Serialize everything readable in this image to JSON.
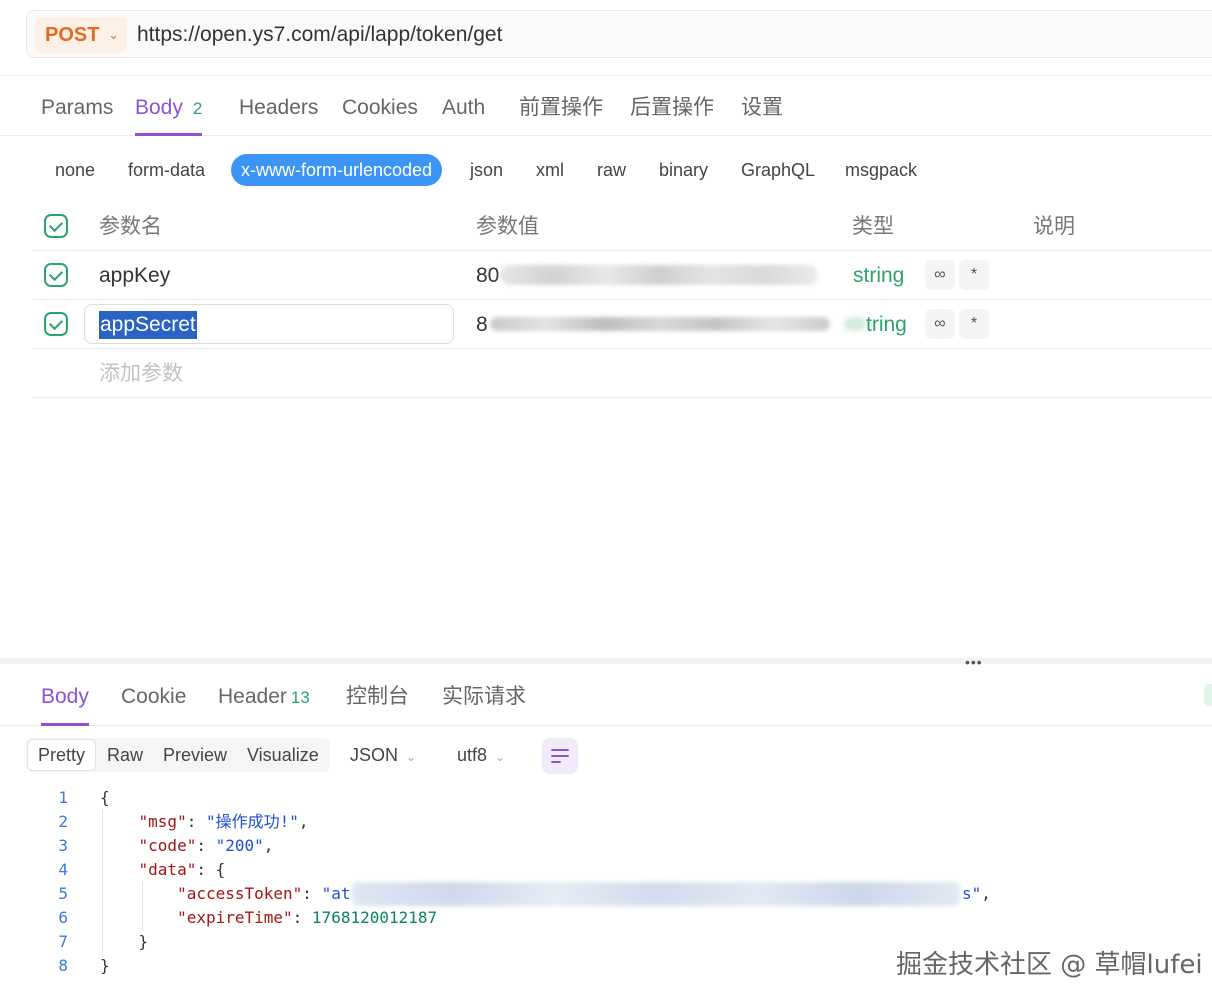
{
  "request": {
    "method": "POST",
    "url": "https://open.ys7.com/api/lapp/token/get"
  },
  "request_tabs": [
    {
      "label": "Params"
    },
    {
      "label": "Body",
      "count": "2"
    },
    {
      "label": "Headers"
    },
    {
      "label": "Cookies"
    },
    {
      "label": "Auth"
    },
    {
      "label": "前置操作"
    },
    {
      "label": "后置操作"
    },
    {
      "label": "设置"
    }
  ],
  "body_types": [
    "none",
    "form-data",
    "x-www-form-urlencoded",
    "json",
    "xml",
    "raw",
    "binary",
    "GraphQL",
    "msgpack"
  ],
  "params_table": {
    "headers": {
      "name": "参数名",
      "value": "参数值",
      "type": "类型",
      "description": "说明"
    },
    "rows": [
      {
        "name": "appKey",
        "value_visible": "80",
        "type": "string",
        "enabled": true
      },
      {
        "name": "appSecret",
        "value_visible": "8",
        "type": "tring",
        "enabled": true
      }
    ],
    "add_placeholder": "添加参数"
  },
  "icons": {
    "dropdown": "chevron-down-icon",
    "link": "link-icon",
    "required": "asterisk-icon",
    "wrap": "wrap-lines-icon",
    "check": "check-icon"
  },
  "colors": {
    "accent": "#8c52d6",
    "method": "#e56a1e",
    "success": "#2aa56a",
    "selected_chip": "#3c95f4"
  },
  "response_tabs": [
    {
      "label": "Body"
    },
    {
      "label": "Cookie"
    },
    {
      "label": "Header",
      "count": "13"
    },
    {
      "label": "控制台"
    },
    {
      "label": "实际请求"
    }
  ],
  "response_view": {
    "modes": [
      "Pretty",
      "Raw",
      "Preview",
      "Visualize"
    ],
    "format": "JSON",
    "encoding": "utf8"
  },
  "response_code": {
    "line_numbers": [
      "1",
      "2",
      "3",
      "4",
      "5",
      "6",
      "7",
      "8"
    ],
    "msg_key": "\"msg\"",
    "msg_value": "\"操作成功!\"",
    "code_key": "\"code\"",
    "code_value": "\"200\"",
    "data_key": "\"data\"",
    "token_key": "\"accessToken\"",
    "token_start": "\"at",
    "token_end": "s\"",
    "expire_key": "\"expireTime\"",
    "expire_value": "1768120012187"
  },
  "watermark": "掘金技术社区 @ 草帽lufei"
}
